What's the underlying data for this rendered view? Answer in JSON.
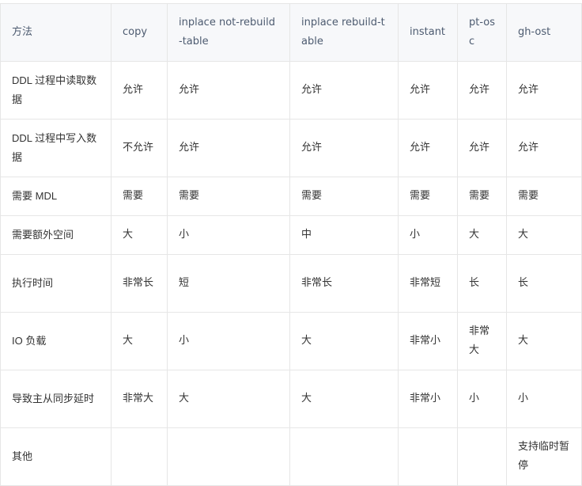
{
  "table": {
    "headers": [
      "方法",
      "copy",
      "inplace not-rebuild-table",
      "inplace rebuild-table",
      "instant",
      "pt-osc",
      "gh-ost"
    ],
    "rows": [
      [
        "DDL 过程中读取数据",
        "允许",
        "允许",
        "允许",
        "允许",
        "允许",
        "允许"
      ],
      [
        "DDL 过程中写入数据",
        "不允许",
        "允许",
        "允许",
        "允许",
        "允许",
        "允许"
      ],
      [
        "需要 MDL",
        "需要",
        "需要",
        "需要",
        "需要",
        "需要",
        "需要"
      ],
      [
        "需要额外空间",
        "大",
        "小",
        "中",
        "小",
        "大",
        "大"
      ],
      [
        "执行时间",
        "非常长",
        "短",
        "非常长",
        "非常短",
        "长",
        "长"
      ],
      [
        "IO 负载",
        "大",
        "小",
        "大",
        "非常小",
        "非常大",
        "大"
      ],
      [
        "导致主从同步延时",
        "非常大",
        "大",
        "大",
        "非常小",
        "小",
        "小"
      ],
      [
        "其他",
        "",
        "",
        "",
        "",
        "",
        "支持临时暂停"
      ]
    ]
  }
}
